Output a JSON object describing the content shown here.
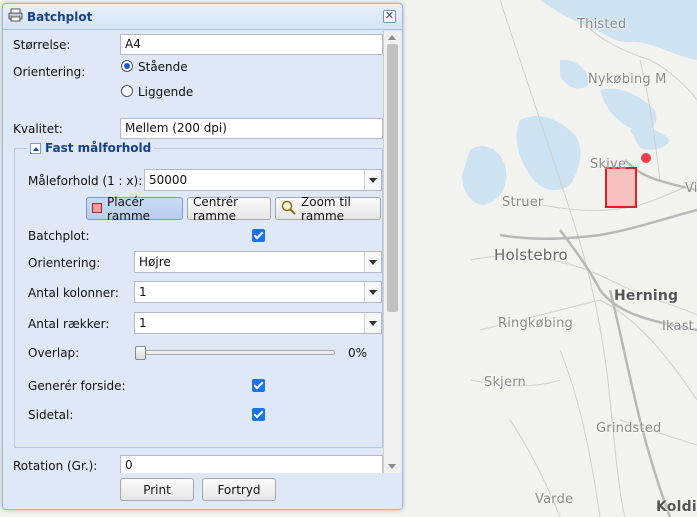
{
  "map": {
    "labels": [
      "Thisted",
      "Nykøbing M",
      "Skive",
      "Vi",
      "Struer",
      "Holstebro",
      "Herning",
      "Ringkøbing",
      "Ikast",
      "Skjern",
      "Grindsted",
      "Varde",
      "Koldi"
    ],
    "frame_color": "#e02020",
    "marker_color": "#e8404a"
  },
  "dialog": {
    "title": "Batchplot",
    "close_glyph": "✕",
    "size_label": "Størrelse:",
    "size_value": "A4",
    "orientation_label": "Orientering:",
    "orientation_portrait": "Stående",
    "orientation_landscape": "Liggende",
    "quality_label": "Kvalitet:",
    "quality_value": "Mellem (200 dpi)",
    "fieldset_title": "Fast målforhold",
    "scale_label": "Måleforhold (1 : x):",
    "scale_value": "50000",
    "place_frame": "Placér ramme",
    "center_frame": "Centrér ramme",
    "zoom_frame": "Zoom til ramme",
    "batchplot_label": "Batchplot:",
    "batch_orientation_label": "Orientering:",
    "batch_orientation_value": "Højre",
    "columns_label": "Antal kolonner:",
    "columns_value": "1",
    "rows_label": "Antal rækker:",
    "rows_value": "1",
    "overlap_label": "Overlap:",
    "overlap_value": "0%",
    "overlap_fraction": 0,
    "frontpage_label": "Generér forside:",
    "pagenum_label": "Sidetal:",
    "rotation_label": "Rotation (Gr.):",
    "rotation_value": "0",
    "print_label": "Print",
    "cancel_label": "Fortryd"
  }
}
